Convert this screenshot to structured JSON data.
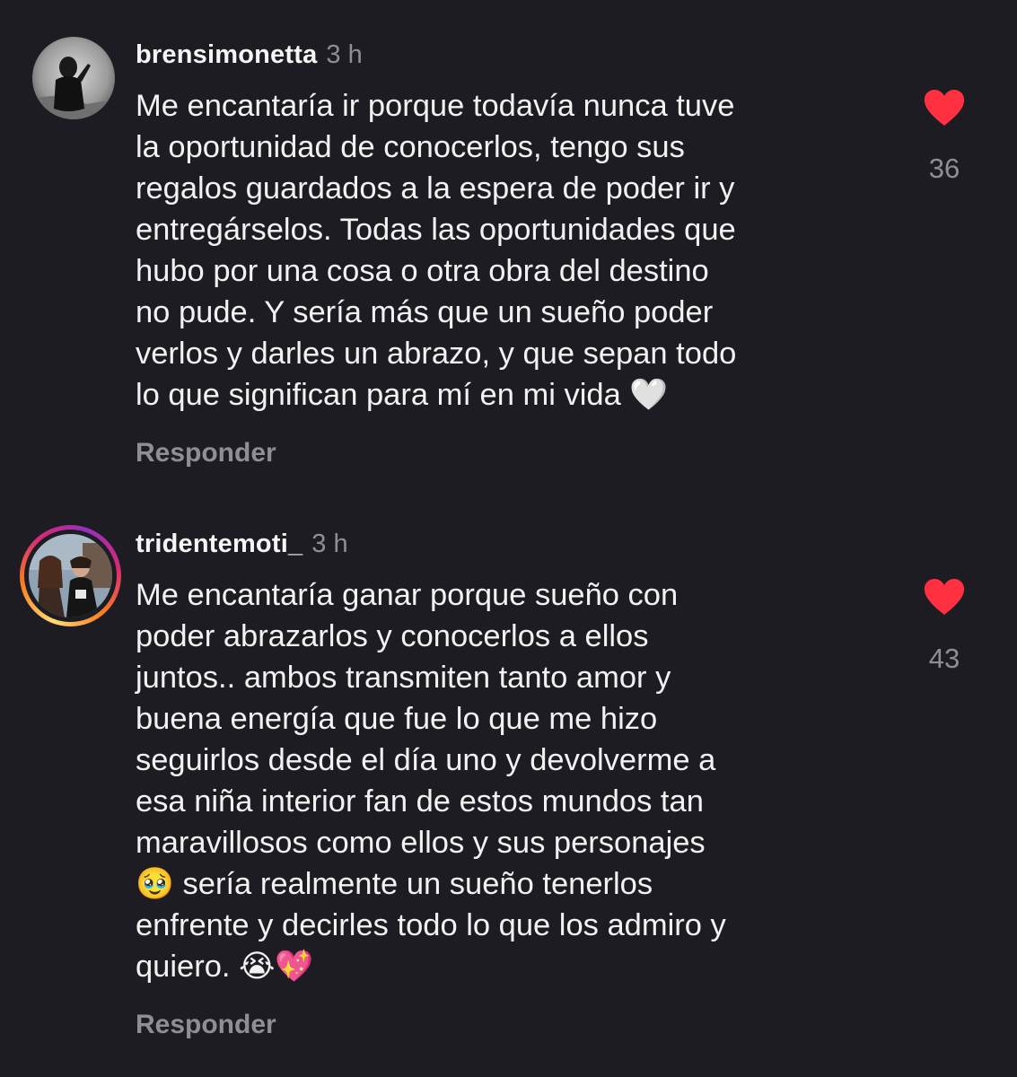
{
  "comments": [
    {
      "username": "brensimonetta",
      "time": "3 h",
      "text": "Me encantaría ir porque todavía nunca tuve\nla oportunidad de conocerlos, tengo sus\nregalos guardados a la espera de poder ir y\nentregárselos. Todas las oportunidades que\nhubo por una cosa o otra obra del destino\nno pude. Y sería más que un sueño poder\nverlos y darles un abrazo, y que sepan todo\nlo que significan para mí en mi vida 🤍",
      "reply_label": "Responder",
      "likes": "36",
      "liked": true,
      "avatar_icon": "avatar-photo",
      "has_story_ring": false
    },
    {
      "username": "tridentemoti_",
      "time": "3 h",
      "text": "Me encantaría ganar porque sueño con\npoder abrazarlos y conocerlos a ellos\njuntos.. ambos transmiten tanto amor y\nbuena energía que fue lo que me hizo\nseguirlos desde el día uno y devolverme a\nesa niña interior fan de estos mundos tan\nmaravillosos como ellos y sus personajes\n🥹 sería realmente un sueño tenerlos\nenfrente y decirles todo lo que los admiro y\nquiero. 😭💖",
      "reply_label": "Responder",
      "likes": "43",
      "liked": true,
      "avatar_icon": "avatar-photo",
      "has_story_ring": true
    }
  ],
  "colors": {
    "background": "#1c1c22",
    "like_red": "#ff3040",
    "muted": "#8e8e93",
    "text": "#f2f2f2"
  },
  "icons": {
    "like": "heart-icon"
  }
}
